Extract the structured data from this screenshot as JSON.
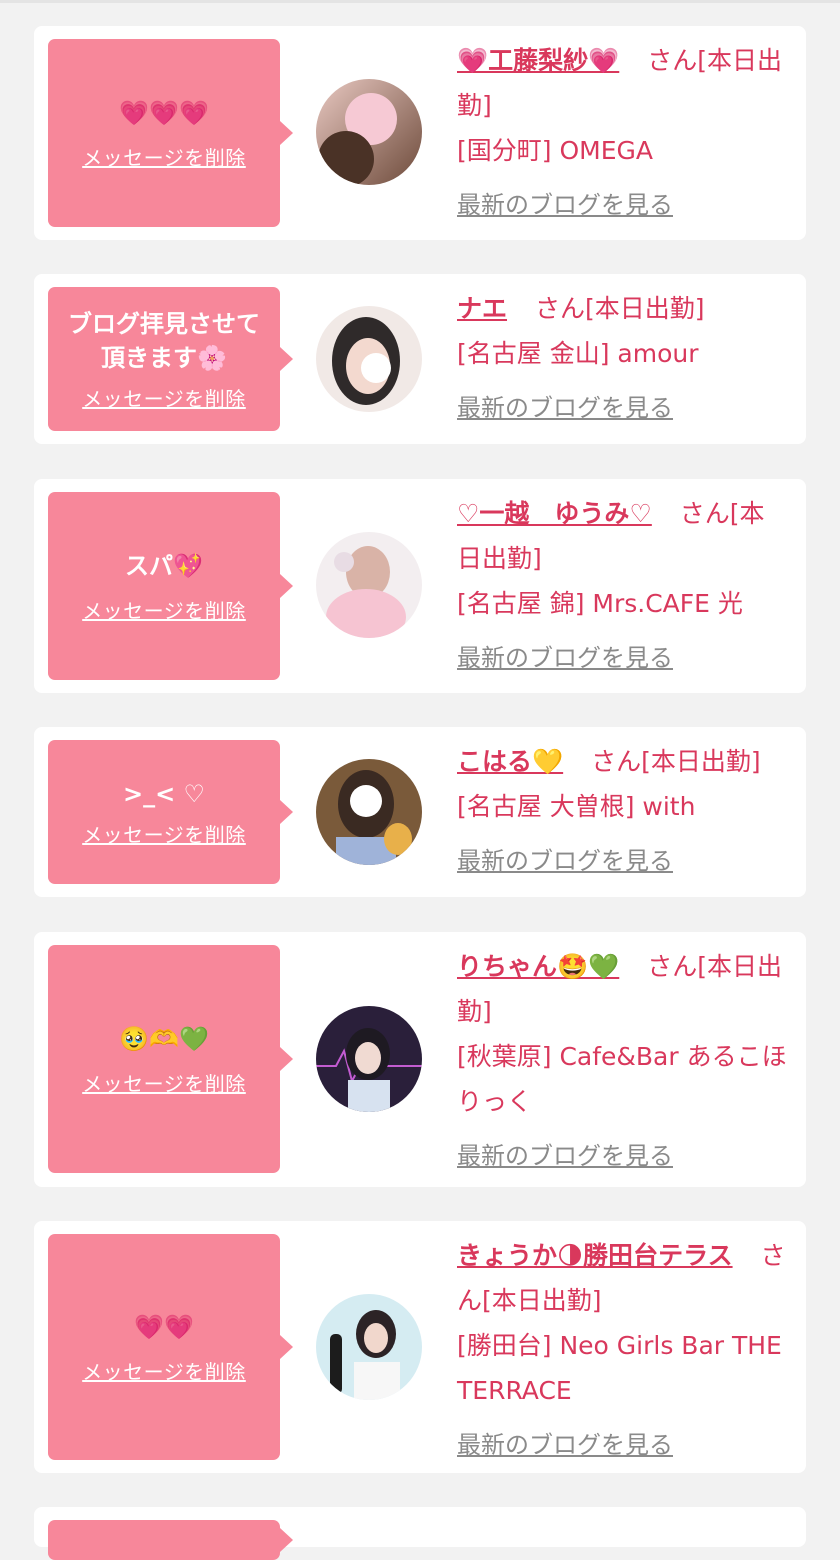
{
  "cards": [
    {
      "message": "💗💗💗",
      "delete_label": "メッセージを削除",
      "name": "💗工藤梨紗💗",
      "suffix": "さん[本日出勤]",
      "shop": "[国分町] OMEGA",
      "blog_link": "最新のブログを見る"
    },
    {
      "message": "ブログ拝見させて頂きます🌸",
      "delete_label": "メッセージを削除",
      "name": "ナエ",
      "suffix": "さん[本日出勤]",
      "shop": "[名古屋 金山] amour",
      "blog_link": "最新のブログを見る"
    },
    {
      "message": "スパ💖",
      "delete_label": "メッセージを削除",
      "name": "♡一越　ゆうみ♡",
      "suffix": "さん[本日出勤]",
      "shop": "[名古屋 錦] Mrs.CAFE 光",
      "blog_link": "最新のブログを見る"
    },
    {
      "message": ">_< ♡",
      "delete_label": "メッセージを削除",
      "name": "こはる💛",
      "suffix": "さん[本日出勤]",
      "shop": "[名古屋 大曽根] with",
      "blog_link": "最新のブログを見る"
    },
    {
      "message": "🥹🫶💚",
      "delete_label": "メッセージを削除",
      "name": "りちゃん🤩💚",
      "suffix": "さん[本日出勤]",
      "shop": "[秋葉原] Cafe&Bar あるこほりっく",
      "blog_link": "最新のブログを見る"
    },
    {
      "message": "💗💗",
      "delete_label": "メッセージを削除",
      "name": "きょうか🌗勝田台テラス",
      "suffix": "さん[本日出勤]",
      "shop": "[勝田台] Neo Girls Bar THE TERRACE",
      "blog_link": "最新のブログを見る"
    }
  ]
}
